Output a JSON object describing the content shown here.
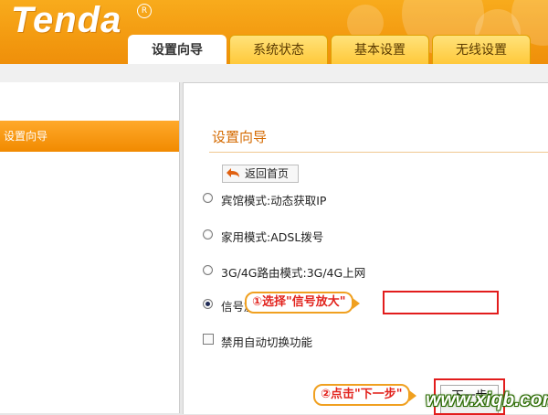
{
  "header": {
    "logo": "Tenda",
    "registered_mark": "R",
    "tabs": [
      {
        "label": "设置向导",
        "active": true
      },
      {
        "label": "系统状态",
        "active": false
      },
      {
        "label": "基本设置",
        "active": false
      },
      {
        "label": "无线设置",
        "active": false
      }
    ]
  },
  "sidebar": {
    "items": [
      {
        "label": "设置向导",
        "active": true
      }
    ]
  },
  "main": {
    "title": "设置向导",
    "back_label": "返回首页",
    "options": [
      {
        "label": "宾馆模式:动态获取IP",
        "selected": false
      },
      {
        "label": "家用模式:ADSL拨号",
        "selected": false
      },
      {
        "label": "3G/4G路由模式:3G/4G上网",
        "selected": false
      },
      {
        "label": "信号放大:WISP",
        "selected": true
      }
    ],
    "checkbox_label": "禁用自动切换功能",
    "next_label": "下一步"
  },
  "annotations": {
    "step1": "①选择\"信号放大\"",
    "step2": "②点击\"下一步\""
  },
  "watermark": "www.xiqb.com",
  "colors": {
    "header_orange": "#f39a10",
    "title_orange": "#d46a00",
    "highlight_red": "#e21c1c",
    "callout_border": "#f0a020"
  }
}
